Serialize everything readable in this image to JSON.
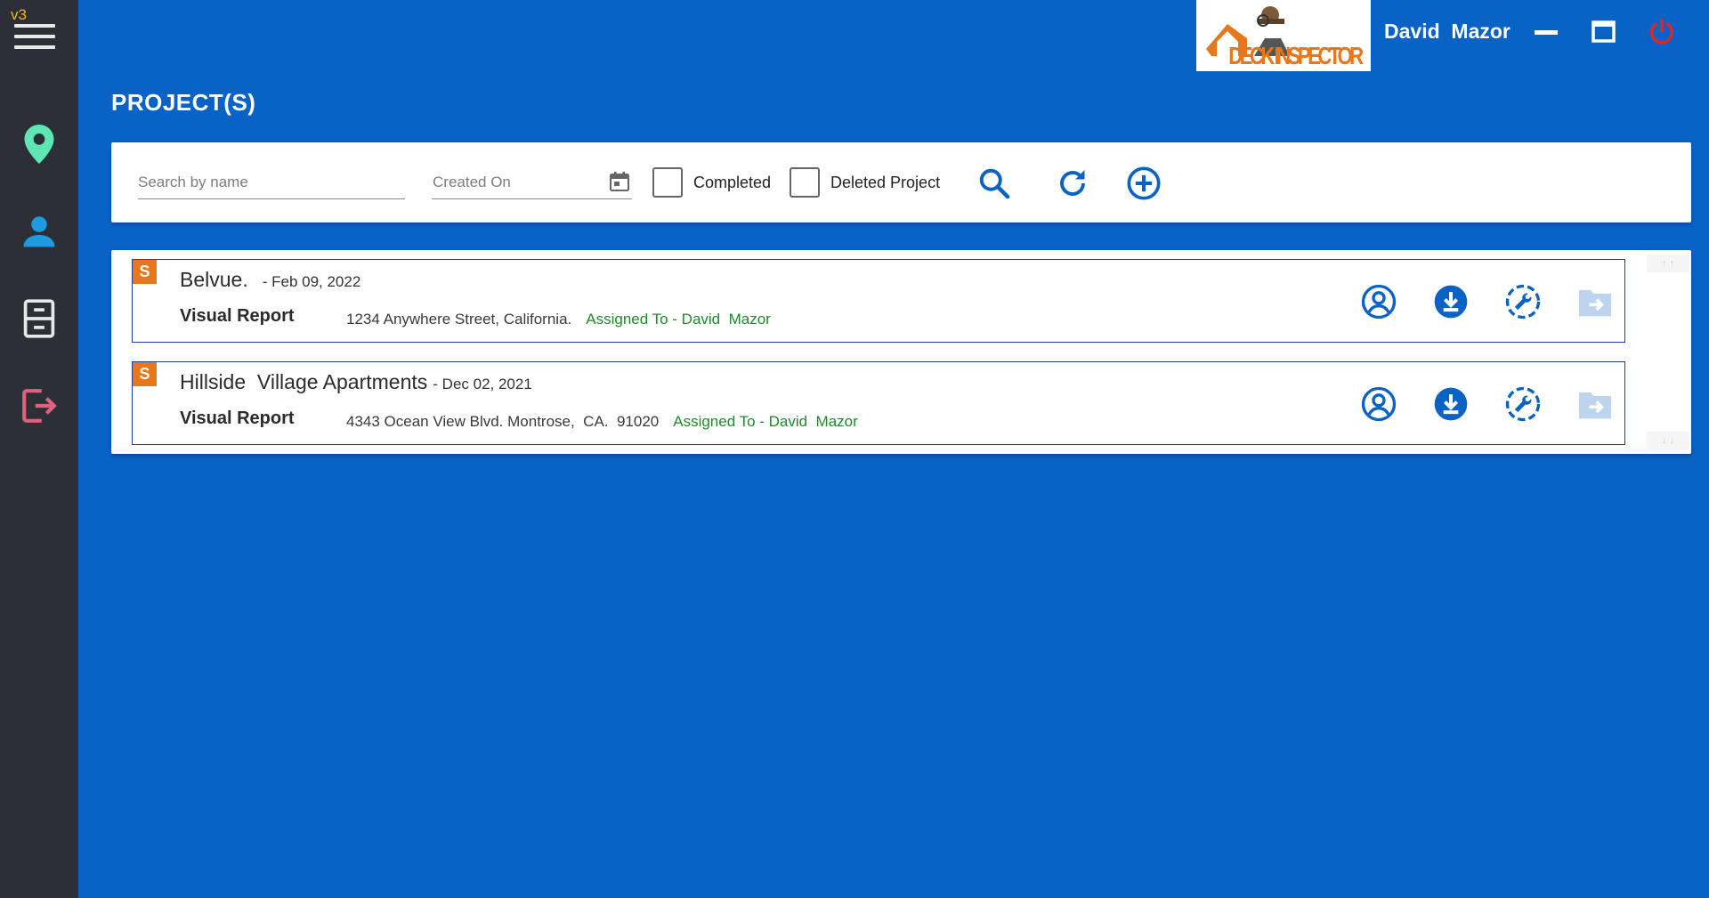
{
  "app": {
    "version": "v3",
    "logo_text": "DECK INSPECTOR",
    "user_name": "David  Mazor"
  },
  "sidebar": {
    "items": [
      {
        "icon": "location-pin-icon",
        "color": "#5ee6b4"
      },
      {
        "icon": "user-icon",
        "color": "#1e9ae0"
      },
      {
        "icon": "file-cabinet-icon",
        "color": "#e8e8e8"
      },
      {
        "icon": "logout-icon",
        "color": "#e0607e"
      }
    ]
  },
  "page": {
    "title": "PROJECT(S)"
  },
  "filters": {
    "search_placeholder": "Search by name",
    "created_on_placeholder": "Created On",
    "completed_label": "Completed",
    "deleted_label": "Deleted Project"
  },
  "colors": {
    "background": "#0962c6",
    "sidebar": "#2c3036",
    "accent": "#0962c6",
    "badge": "#e8761a",
    "assigned": "#1f8a2a",
    "logout": "#d42a2a"
  },
  "projects": [
    {
      "badge": "S",
      "name": "Belvue.",
      "date": "- Feb 09, 2022",
      "report_type": "Visual Report",
      "address": "1234 Anywhere Street, California.",
      "assigned": "Assigned To - David  Mazor"
    },
    {
      "badge": "S",
      "name": "Hillside  Village Apartments",
      "date": "- Dec 02, 2021",
      "report_type": "Visual Report",
      "address": "4343 Ocean View Blvd. Montrose,  CA.  91020",
      "assigned": "Assigned To - David  Mazor"
    }
  ]
}
